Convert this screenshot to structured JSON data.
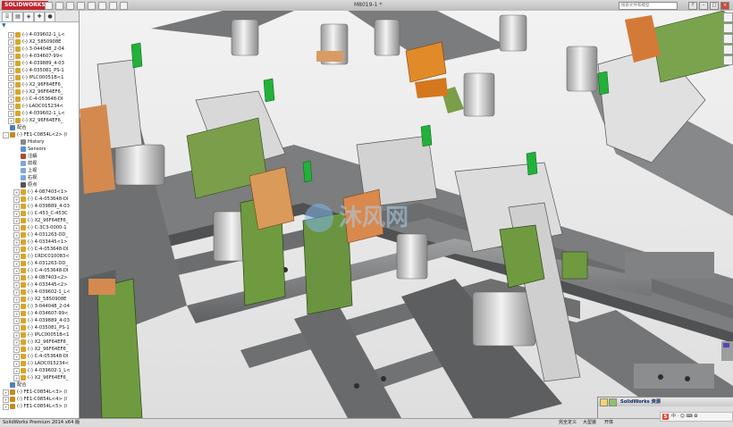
{
  "app": {
    "logo_text": "SOLIDWORKS",
    "document_title": "M8019-1 *",
    "search_placeholder": "搜索文件和模型",
    "window_buttons": [
      "–",
      "□",
      "×"
    ]
  },
  "panel": {
    "tabs": [
      "feature-tree",
      "property-manager",
      "configuration-manager",
      "dimxpert",
      "display-manager"
    ],
    "filter_icon": "filter-icon"
  },
  "tree": [
    {
      "label": "(-) 4-039602-1_L<",
      "expand": "+",
      "icon": "part"
    },
    {
      "label": "(-) X2_5850908E",
      "expand": "+",
      "icon": "part"
    },
    {
      "label": "(-) 3-044048_2-04",
      "expand": "+",
      "icon": "part"
    },
    {
      "label": "(-) 4-034607-99<",
      "expand": "+",
      "icon": "part"
    },
    {
      "label": "(-) 4-039889_4-03",
      "expand": "+",
      "icon": "part"
    },
    {
      "label": "(-) 4-035081_PS-1",
      "expand": "+",
      "icon": "part"
    },
    {
      "label": "(-) IPLC00051B<1",
      "expand": "+",
      "icon": "part"
    },
    {
      "label": "(-) X2_96F64EF6_",
      "expand": "+",
      "icon": "part"
    },
    {
      "label": "(-) X2_96F64EF6_",
      "expand": "+",
      "icon": "part"
    },
    {
      "label": "(-) C-4-053648-DI",
      "expand": "+",
      "icon": "part"
    },
    {
      "label": "(-) LADC015234<",
      "expand": "+",
      "icon": "part"
    },
    {
      "label": "(-) 4-039602-1_L<",
      "expand": "+",
      "icon": "part"
    },
    {
      "label": "(-) X2_96F64EF6_",
      "expand": "+",
      "icon": "part"
    },
    {
      "label": "配合",
      "expand": "",
      "icon": "mates"
    },
    {
      "label": "(-) FE1-C0854L<2> (I",
      "expand": "-",
      "icon": "assembly"
    },
    {
      "label": "History",
      "expand": "",
      "icon": "history"
    },
    {
      "label": "Sensors",
      "expand": "",
      "icon": "sensor"
    },
    {
      "label": "注解",
      "expand": "",
      "icon": "annotation"
    },
    {
      "label": "前视",
      "expand": "",
      "icon": "plane"
    },
    {
      "label": "上视",
      "expand": "",
      "icon": "plane"
    },
    {
      "label": "右视",
      "expand": "",
      "icon": "plane"
    },
    {
      "label": "原点",
      "expand": "",
      "icon": "origin"
    },
    {
      "label": "(-) 4-087403<1>",
      "expand": "+",
      "icon": "part"
    },
    {
      "label": "(-) C-4-053648-DI",
      "expand": "+",
      "icon": "part"
    },
    {
      "label": "(-) 4-039889_4-03",
      "expand": "+",
      "icon": "part"
    },
    {
      "label": "(-) C-453_C-453C",
      "expand": "+",
      "icon": "part"
    },
    {
      "label": "(-) X2_96F64EF6_",
      "expand": "+",
      "icon": "part"
    },
    {
      "label": "(-) C-3C3-0000-1",
      "expand": "+",
      "icon": "part"
    },
    {
      "label": "(-) 4-031263-DD_",
      "expand": "+",
      "icon": "part"
    },
    {
      "label": "(-) 4-033445<1>",
      "expand": "+",
      "icon": "part"
    },
    {
      "label": "(-) C-4-053648-DI",
      "expand": "+",
      "icon": "part"
    },
    {
      "label": "(-) CRDC010083<",
      "expand": "+",
      "icon": "part"
    },
    {
      "label": "(-) 4-031263-DD_",
      "expand": "+",
      "icon": "part"
    },
    {
      "label": "(-) C-4-053648-DI",
      "expand": "+",
      "icon": "part"
    },
    {
      "label": "(-) 4-087403<2>",
      "expand": "+",
      "icon": "part"
    },
    {
      "label": "(-) 4-033445<2>",
      "expand": "+",
      "icon": "part"
    },
    {
      "label": "(-) 4-039602-1_L<",
      "expand": "+",
      "icon": "part"
    },
    {
      "label": "(-) X2_5850908E",
      "expand": "+",
      "icon": "part"
    },
    {
      "label": "(-) 3-044048_2-04",
      "expand": "+",
      "icon": "part"
    },
    {
      "label": "(-) 4-034607-99<",
      "expand": "+",
      "icon": "part"
    },
    {
      "label": "(-) 4-039889_4-03",
      "expand": "+",
      "icon": "part"
    },
    {
      "label": "(-) 4-035081_PS-1",
      "expand": "+",
      "icon": "part"
    },
    {
      "label": "(-) IPLC00051B<1",
      "expand": "+",
      "icon": "part"
    },
    {
      "label": "(-) X2_96F64EF6_",
      "expand": "+",
      "icon": "part"
    },
    {
      "label": "(-) X2_96F64EF6_",
      "expand": "+",
      "icon": "part"
    },
    {
      "label": "(-) C-4-053648-DI",
      "expand": "+",
      "icon": "part"
    },
    {
      "label": "(-) LADC015234<",
      "expand": "+",
      "icon": "part"
    },
    {
      "label": "(-) 4-039602-1_L<",
      "expand": "+",
      "icon": "part"
    },
    {
      "label": "(-) X2_96F64EF6_",
      "expand": "+",
      "icon": "part"
    },
    {
      "label": "配合",
      "expand": "",
      "icon": "mates"
    },
    {
      "label": "(-) FE1-C0854L<3> (I",
      "expand": "+",
      "icon": "assembly"
    },
    {
      "label": "(-) FE1-C0854L<4> (I",
      "expand": "+",
      "icon": "assembly"
    },
    {
      "label": "(-) FE1-C0854L<5> (I",
      "expand": "+",
      "icon": "assembly"
    }
  ],
  "icon_colors": {
    "part": "#d9a52a",
    "assembly": "#c98a1c",
    "mates": "#4f7fb8",
    "history": "#8a8a8a",
    "sensor": "#5a8fd0",
    "annotation": "#b04a2a",
    "plane": "#7fa7d8",
    "origin": "#555555"
  },
  "viewport": {
    "watermark_text": "沐风网",
    "description_colors": {
      "frame": "#6f7172",
      "green": "#6f9a40",
      "orange": "#d58a43",
      "cylinder": "#cfcfcf",
      "bright_green": "#23b23a"
    }
  },
  "task_pane": {
    "label": "SolidWorks 资源"
  },
  "status": {
    "app_version": "SolidWorks Premium 2014 x64 版",
    "state": "完全定义",
    "mode": "大型装",
    "extra": "开体"
  },
  "ime": {
    "logo": "S",
    "text": "中 · ☺ ⌨ ✿"
  }
}
